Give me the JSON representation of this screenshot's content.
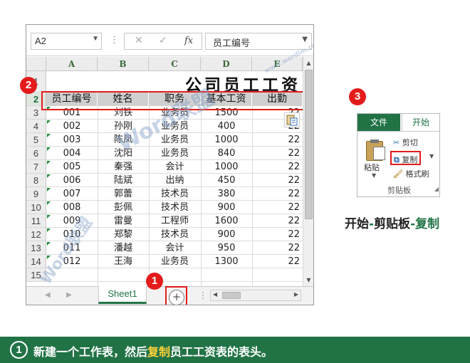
{
  "formula_bar": {
    "name_box": "A2",
    "cancel_icon": "✕",
    "enter_icon": "✓",
    "fx_label": "fx",
    "content": "员工编号"
  },
  "columns": [
    "A",
    "B",
    "C",
    "D",
    "E"
  ],
  "rows": [
    "1",
    "2",
    "3",
    "4",
    "5",
    "6",
    "7",
    "8",
    "9",
    "10",
    "11",
    "12",
    "13",
    "14",
    "15"
  ],
  "selected_row": "2",
  "sheet": {
    "title": "公司员工工资",
    "headers": [
      "员工编号",
      "姓名",
      "职务",
      "基本工资",
      "出勤"
    ],
    "data": [
      [
        "001",
        "刘铁",
        "业务员",
        "1500",
        "22"
      ],
      [
        "002",
        "孙刚",
        "业务员",
        "400",
        "22"
      ],
      [
        "003",
        "陈凤",
        "业务员",
        "1000",
        "22"
      ],
      [
        "004",
        "沈阳",
        "业务员",
        "840",
        "22"
      ],
      [
        "005",
        "秦强",
        "会计",
        "1000",
        "22"
      ],
      [
        "006",
        "陆斌",
        "出纳",
        "450",
        "22"
      ],
      [
        "007",
        "郭蕾",
        "技术员",
        "380",
        "22"
      ],
      [
        "008",
        "彭佩",
        "技术员",
        "900",
        "22"
      ],
      [
        "009",
        "雷曼",
        "工程师",
        "1600",
        "22"
      ],
      [
        "010",
        "郑黎",
        "技术员",
        "900",
        "22"
      ],
      [
        "011",
        "潘越",
        "会计",
        "950",
        "22"
      ],
      [
        "012",
        "王海",
        "业务员",
        "1300",
        "22"
      ]
    ]
  },
  "sheet_tabs": {
    "active": "Sheet1",
    "add_symbol": "+"
  },
  "badges": {
    "one": "1",
    "two": "2",
    "three": "3"
  },
  "ribbon": {
    "tab_file": "文件",
    "tab_home": "开始",
    "paste": "粘贴",
    "cut": "剪切",
    "copy": "复制",
    "format_painter": "格式刷",
    "group": "剪贴板"
  },
  "breadcrumb": {
    "part1": "开始",
    "sep1": "-",
    "part2": "剪贴板",
    "sep2": "-",
    "part3": "复制"
  },
  "watermark": {
    "brand": "Word联盟",
    "url": "www.wordlm.com"
  },
  "caption": {
    "num": "1",
    "before": "新建一个工作表，然后",
    "highlight": "复制",
    "after": "员工工资表的表头。"
  },
  "colors": {
    "accent_green": "#217346",
    "highlight_red": "#e41b1b",
    "caption_yellow": "#ffd23a"
  }
}
